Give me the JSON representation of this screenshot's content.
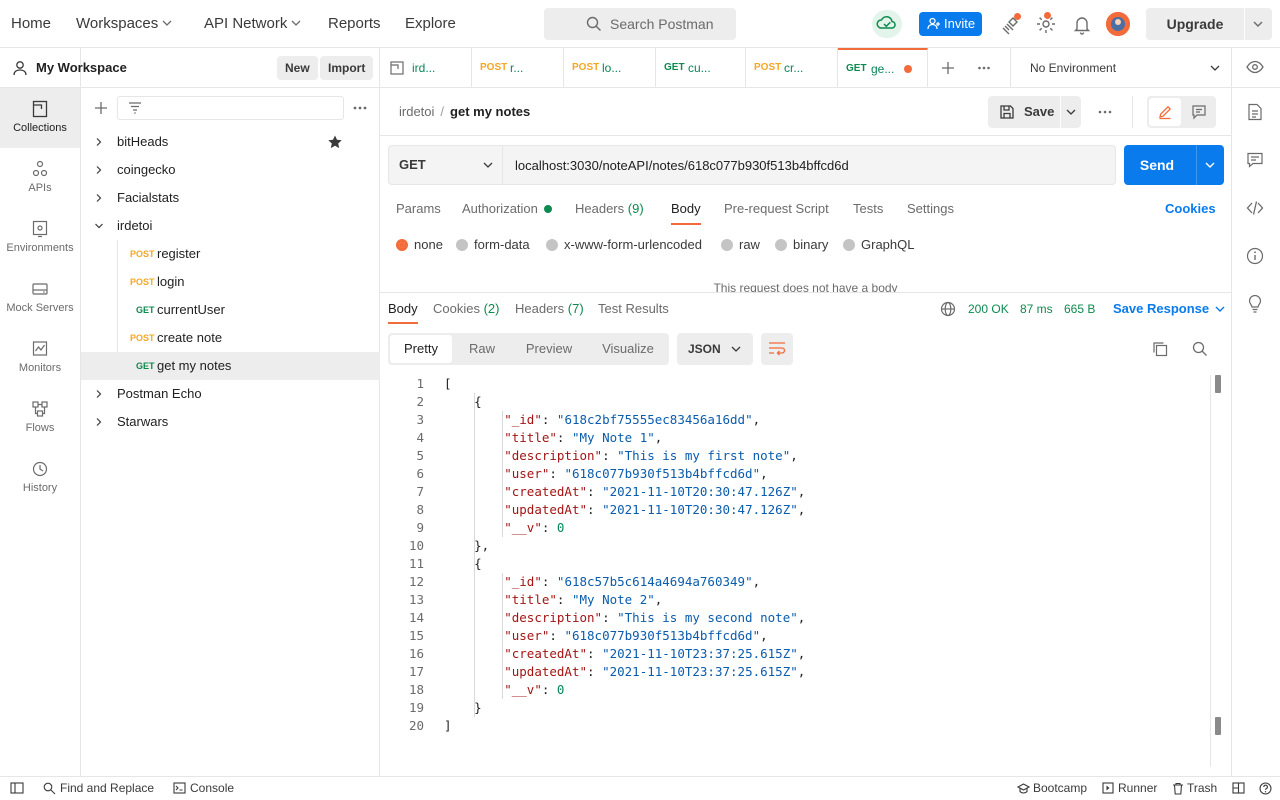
{
  "header": {
    "nav": [
      "Home",
      "Workspaces",
      "API Network",
      "Reports",
      "Explore"
    ],
    "search_placeholder": "Search Postman",
    "invite_label": "Invite",
    "upgrade_label": "Upgrade"
  },
  "workspace": {
    "name": "My Workspace",
    "new_label": "New",
    "import_label": "Import"
  },
  "rail": [
    "Collections",
    "APIs",
    "Environments",
    "Mock Servers",
    "Monitors",
    "Flows",
    "History"
  ],
  "collections": [
    {
      "name": "bitHeads",
      "starred": true
    },
    {
      "name": "coingecko"
    },
    {
      "name": "Facialstats"
    },
    {
      "name": "irdetoi",
      "expanded": true,
      "requests": [
        {
          "method": "POST",
          "name": "register"
        },
        {
          "method": "POST",
          "name": "login"
        },
        {
          "method": "GET",
          "name": "currentUser"
        },
        {
          "method": "POST",
          "name": "create note"
        },
        {
          "method": "GET",
          "name": "get my notes",
          "selected": true
        }
      ]
    },
    {
      "name": "Postman Echo"
    },
    {
      "name": "Starwars"
    }
  ],
  "tabs": [
    {
      "method": "",
      "name": "ird..."
    },
    {
      "method": "POST",
      "name": "r..."
    },
    {
      "method": "POST",
      "name": "lo..."
    },
    {
      "method": "GET",
      "name": "cu..."
    },
    {
      "method": "POST",
      "name": "cr..."
    },
    {
      "method": "GET",
      "name": "ge...",
      "active": true
    }
  ],
  "environment": "No Environment",
  "request": {
    "collection": "irdetoi",
    "name": "get my notes",
    "save_label": "Save",
    "method": "GET",
    "url": "localhost:3030/noteAPI/notes/618c077b930f513b4bffcd6d",
    "send_label": "Send",
    "tabs": {
      "params": "Params",
      "authorization": "Authorization",
      "headers": "Headers",
      "headers_count": "(9)",
      "body": "Body",
      "prerequest": "Pre-request Script",
      "tests": "Tests",
      "settings": "Settings"
    },
    "cookies_label": "Cookies",
    "body_types": [
      "none",
      "form-data",
      "x-www-form-urlencoded",
      "raw",
      "binary",
      "GraphQL"
    ],
    "no_body_text": "This request does not have a body"
  },
  "response": {
    "tabs": {
      "body": "Body",
      "cookies": "Cookies",
      "cookies_count": "(2)",
      "headers": "Headers",
      "headers_count": "(7)",
      "test_results": "Test Results"
    },
    "status": "200 OK",
    "time": "87 ms",
    "size": "665 B",
    "save_label": "Save Response",
    "formats": [
      "Pretty",
      "Raw",
      "Preview",
      "Visualize"
    ],
    "language": "JSON",
    "notes": [
      {
        "_id": "618c2bf75555ec83456a16dd",
        "title": "My Note 1",
        "description": "This is my first note",
        "user": "618c077b930f513b4bffcd6d",
        "createdAt": "2021-11-10T20:30:47.126Z",
        "updatedAt": "2021-11-10T20:30:47.126Z",
        "__v": 0
      },
      {
        "_id": "618c57b5c614a4694a760349",
        "title": "My Note 2",
        "description": "This is my second note",
        "user": "618c077b930f513b4bffcd6d",
        "createdAt": "2021-11-10T23:37:25.615Z",
        "updatedAt": "2021-11-10T23:37:25.615Z",
        "__v": 0
      }
    ]
  },
  "statusbar": {
    "find_replace": "Find and Replace",
    "console": "Console",
    "bootcamp": "Bootcamp",
    "runner": "Runner",
    "trash": "Trash"
  },
  "colors": {
    "accent": "#f26b3a",
    "primary": "#097bed",
    "get": "#0d8a4f",
    "post": "#f6a623"
  }
}
